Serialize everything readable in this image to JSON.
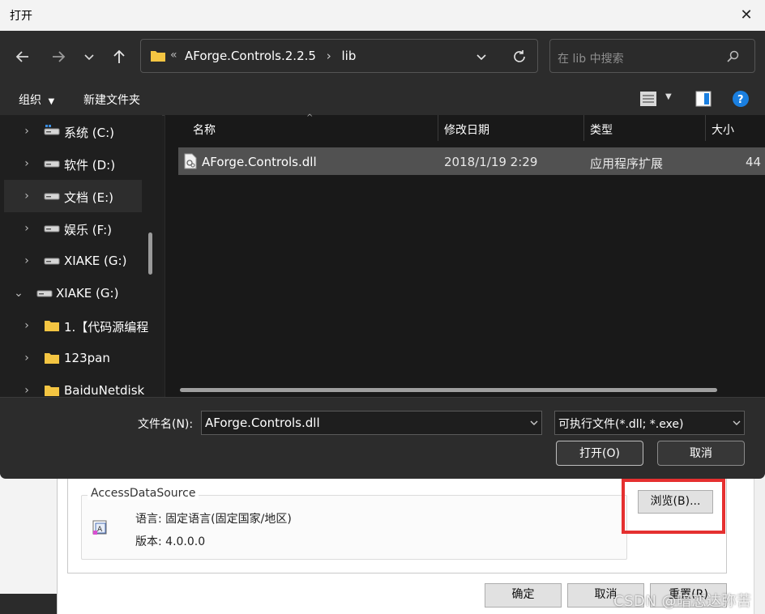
{
  "dialog": {
    "title": "打开",
    "address": {
      "overflow": "«",
      "segments": [
        "AForge.Controls.2.2.5",
        "lib"
      ],
      "separator": "›"
    },
    "search_placeholder": "在 lib 中搜索",
    "toolbar": {
      "organize": "组织",
      "new_folder": "新建文件夹"
    },
    "tree": [
      {
        "label": "系统 (C:)",
        "icon": "drive-icon"
      },
      {
        "label": "软件 (D:)",
        "icon": "drive-icon"
      },
      {
        "label": "文档 (E:)",
        "icon": "drive-icon",
        "selected": true
      },
      {
        "label": "娱乐 (F:)",
        "icon": "drive-icon"
      },
      {
        "label": "XIAKE (G:)",
        "icon": "drive-icon"
      },
      {
        "label": "XIAKE (G:)",
        "icon": "drive-icon",
        "expanded": true
      },
      {
        "label": "1.【代码源编程",
        "icon": "folder-icon"
      },
      {
        "label": "123pan",
        "icon": "folder-icon"
      },
      {
        "label": "BaiduNetdisk",
        "icon": "folder-icon"
      }
    ],
    "columns": {
      "name": "名称",
      "modified": "修改日期",
      "type": "类型",
      "size": "大小"
    },
    "files": [
      {
        "name": "AForge.Controls.dll",
        "modified": "2018/1/19 2:29",
        "type": "应用程序扩展",
        "size": "44"
      }
    ],
    "filename_label": "文件名(N):",
    "filename_value": "AForge.Controls.dll",
    "filter_value": "可执行文件(*.dll; *.exe)",
    "open_button": "打开(O)",
    "cancel_button": "取消"
  },
  "background": {
    "group_title": "AccessDataSource",
    "language": "语言:  固定语言(固定国家/地区)",
    "version": "版本:  4.0.0.0",
    "browse_button": "浏览(B)...",
    "ok_button": "确定",
    "cancel_button": "取消",
    "reset_button": "重置(R)",
    "watermark": "CSDN @暗恋达弥苦"
  },
  "colors": {
    "highlight": "#e53030",
    "folder": "#f4c542",
    "help": "#1a7fe0"
  }
}
